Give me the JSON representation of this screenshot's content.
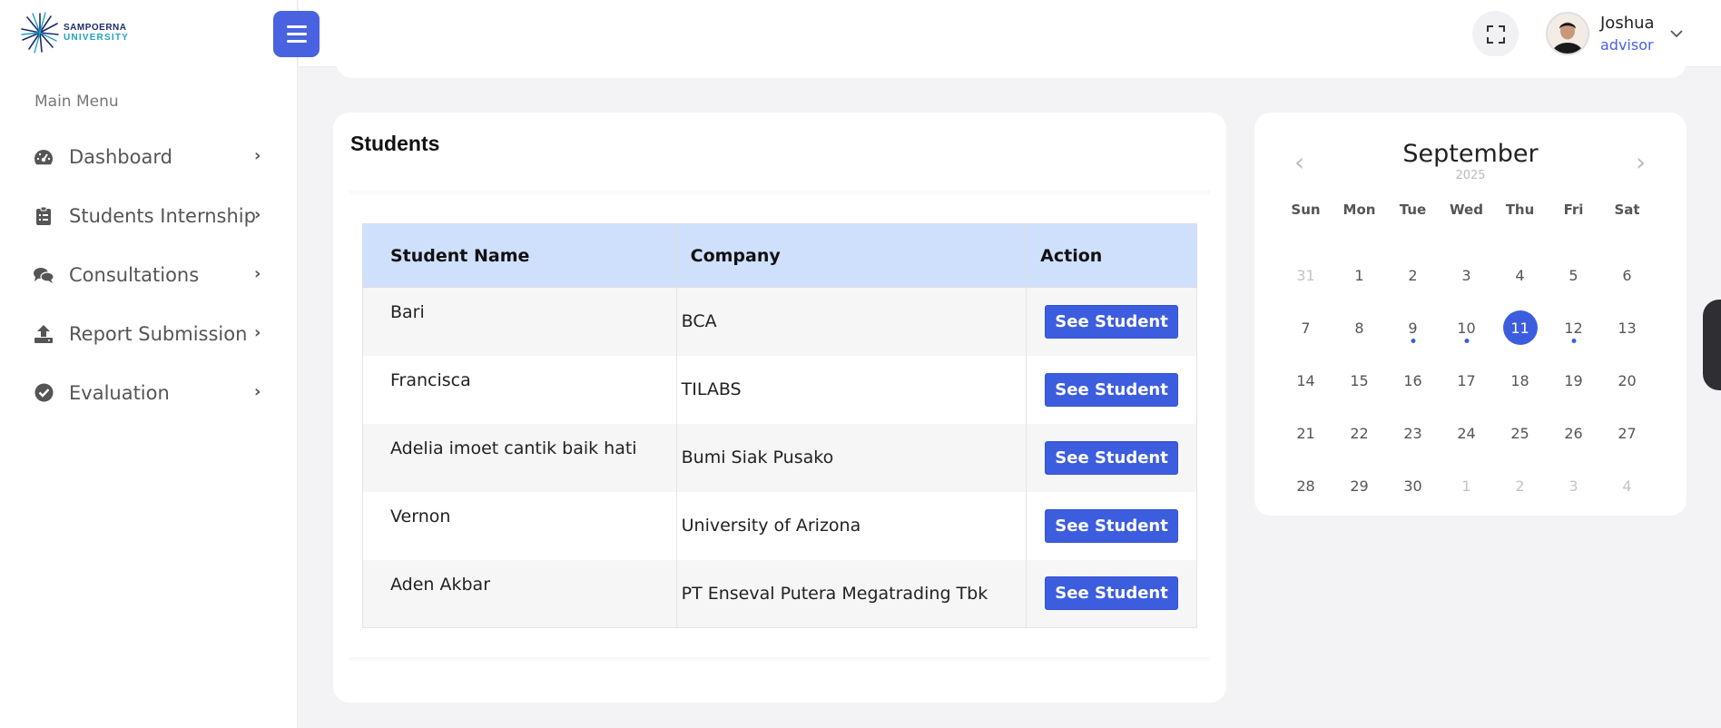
{
  "logo": {
    "line1": "SAMPOERNA",
    "line2": "UNIVERSITY"
  },
  "sidebar": {
    "menu_title": "Main Menu",
    "items": [
      {
        "label": "Dashboard",
        "icon": "dashboard-icon"
      },
      {
        "label": "Students Internship",
        "icon": "clipboard-icon"
      },
      {
        "label": "Consultations",
        "icon": "comments-icon"
      },
      {
        "label": "Report Submission",
        "icon": "upload-icon"
      },
      {
        "label": "Evaluation",
        "icon": "check-circle-icon"
      }
    ]
  },
  "header": {
    "user_name": "Joshua",
    "user_role": "advisor"
  },
  "students": {
    "title": "Students",
    "columns": [
      "Student Name",
      "Company",
      "Action"
    ],
    "rows": [
      {
        "name": "Bari",
        "company": "BCA",
        "action": "See Student"
      },
      {
        "name": "Francisca",
        "company": "TILABS",
        "action": "See Student"
      },
      {
        "name": "Adelia imoet cantik baik hati",
        "company": "Bumi Siak Pusako",
        "action": "See Student"
      },
      {
        "name": "Vernon",
        "company": "University of Arizona",
        "action": "See Student"
      },
      {
        "name": "Aden Akbar",
        "company": "PT Enseval Putera Megatrading Tbk",
        "action": "See Student"
      }
    ]
  },
  "calendar": {
    "month": "September",
    "year": "2025",
    "weekdays": [
      "Sun",
      "Mon",
      "Tue",
      "Wed",
      "Thu",
      "Fri",
      "Sat"
    ],
    "days": [
      {
        "d": "31",
        "muted": true
      },
      {
        "d": "1"
      },
      {
        "d": "2"
      },
      {
        "d": "3"
      },
      {
        "d": "4"
      },
      {
        "d": "5"
      },
      {
        "d": "6"
      },
      {
        "d": "7"
      },
      {
        "d": "8"
      },
      {
        "d": "9",
        "dot": true
      },
      {
        "d": "10",
        "dot": true
      },
      {
        "d": "11",
        "selected": true
      },
      {
        "d": "12",
        "dot": true
      },
      {
        "d": "13"
      },
      {
        "d": "14"
      },
      {
        "d": "15"
      },
      {
        "d": "16"
      },
      {
        "d": "17"
      },
      {
        "d": "18"
      },
      {
        "d": "19"
      },
      {
        "d": "20"
      },
      {
        "d": "21"
      },
      {
        "d": "22"
      },
      {
        "d": "23"
      },
      {
        "d": "24"
      },
      {
        "d": "25"
      },
      {
        "d": "26"
      },
      {
        "d": "27"
      },
      {
        "d": "28"
      },
      {
        "d": "29"
      },
      {
        "d": "30"
      },
      {
        "d": "1",
        "muted": true
      },
      {
        "d": "2",
        "muted": true
      },
      {
        "d": "3",
        "muted": true
      },
      {
        "d": "4",
        "muted": true
      }
    ]
  },
  "colors": {
    "accent": "#3d5ddf",
    "table_header": "#cfe0fd",
    "role_text": "#4862e0"
  }
}
